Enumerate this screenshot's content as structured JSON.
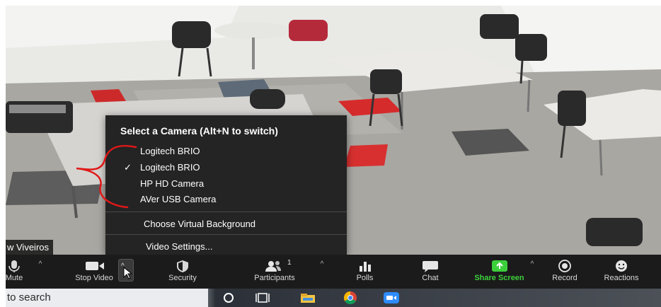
{
  "menu": {
    "title": "Select a Camera (Alt+N to switch)",
    "cameras": [
      {
        "label": "Logitech BRIO",
        "selected": false
      },
      {
        "label": "Logitech BRIO",
        "selected": true
      },
      {
        "label": "HP HD Camera",
        "selected": false
      },
      {
        "label": "AVer USB Camera",
        "selected": false
      }
    ],
    "check_mark": "✓",
    "virtual_background": "Choose Virtual Background",
    "video_settings": "Video Settings..."
  },
  "video": {
    "participant_name": "w Viveiros"
  },
  "toolbar": {
    "mute": "Mute",
    "stop_video": "Stop Video",
    "security": "Security",
    "participants": "Participants",
    "participants_count": "1",
    "polls": "Polls",
    "chat": "Chat",
    "share_screen": "Share Screen",
    "record": "Record",
    "reactions": "Reactions",
    "caret": "^",
    "share_color": "#3ccf3c",
    "annotation_color": "#e01818"
  },
  "taskbar": {
    "search_placeholder": "to search",
    "icons": [
      "task-view-icon",
      "file-explorer-icon",
      "chrome-icon",
      "zoom-icon"
    ]
  }
}
